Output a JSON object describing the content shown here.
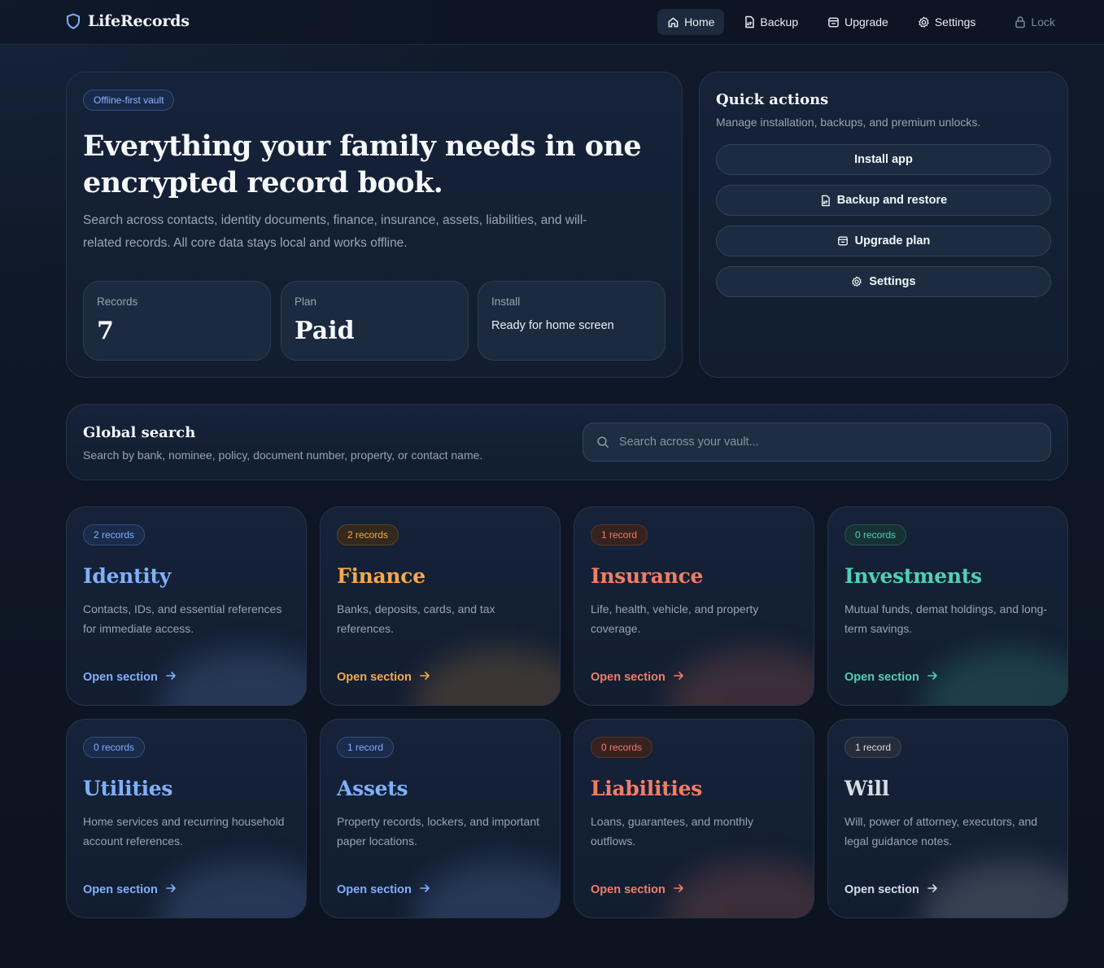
{
  "app": {
    "name": "LifeRecords"
  },
  "nav": [
    {
      "label": "Home",
      "icon": "home-icon",
      "active": true
    },
    {
      "label": "Backup",
      "icon": "backup-icon"
    },
    {
      "label": "Upgrade",
      "icon": "upgrade-icon"
    },
    {
      "label": "Settings",
      "icon": "gear-icon"
    },
    {
      "label": "Lock",
      "icon": "lock-icon"
    }
  ],
  "hero": {
    "badge": "Offline-first vault",
    "title": "Everything your family needs in one encrypted record book.",
    "description": "Search across contacts, identity documents, finance, insurance, assets, liabilities, and will-related records. All core data stays local and works offline.",
    "stats": [
      {
        "label": "Records",
        "value": "7"
      },
      {
        "label": "Plan",
        "value": "Paid"
      },
      {
        "label": "Install",
        "value": "Ready for home screen"
      }
    ]
  },
  "quick_actions": {
    "title": "Quick actions",
    "subtitle": "Manage installation, backups, and premium unlocks.",
    "buttons": [
      {
        "label": "Install app",
        "icon": ""
      },
      {
        "label": "Backup and restore",
        "icon": "backup-icon"
      },
      {
        "label": "Upgrade plan",
        "icon": "upgrade-icon"
      },
      {
        "label": "Settings",
        "icon": "gear-icon"
      }
    ]
  },
  "search": {
    "title": "Global search",
    "subtitle": "Search by bank, nominee, policy, document number, property, or contact name.",
    "placeholder": "Search across your vault..."
  },
  "categories": [
    {
      "title": "Identity",
      "count": "2 records",
      "description": "Contacts, IDs, and essential references for immediate access.",
      "cta": "Open section",
      "color": "#7fb0ff",
      "badge_bg": "#1a2b4b",
      "badge_border": "#34507e"
    },
    {
      "title": "Finance",
      "count": "2 records",
      "description": "Banks, deposits, cards, and tax references.",
      "cta": "Open section",
      "color": "#f6a94a",
      "badge_bg": "#33291d",
      "badge_border": "#5a4426"
    },
    {
      "title": "Insurance",
      "count": "1 record",
      "description": "Life, health, vehicle, and property coverage.",
      "cta": "Open section",
      "color": "#f27d66",
      "badge_bg": "#36221f",
      "badge_border": "#5c322a"
    },
    {
      "title": "Investments",
      "count": "0 records",
      "description": "Mutual funds, demat holdings, and long-term savings.",
      "cta": "Open section",
      "color": "#4fd1b5",
      "badge_bg": "#163232",
      "badge_border": "#28544e"
    },
    {
      "title": "Utilities",
      "count": "0 records",
      "description": "Home services and recurring household account references.",
      "cta": "Open section",
      "color": "#7fb0ff",
      "badge_bg": "#1a2b4b",
      "badge_border": "#34507e"
    },
    {
      "title": "Assets",
      "count": "1 record",
      "description": "Property records, lockers, and important paper locations.",
      "cta": "Open section",
      "color": "#7fb0ff",
      "badge_bg": "#1a2b4b",
      "badge_border": "#34507e"
    },
    {
      "title": "Liabilities",
      "count": "0 records",
      "description": "Loans, guarantees, and monthly outflows.",
      "cta": "Open section",
      "color": "#f27d66",
      "badge_bg": "#36221f",
      "badge_border": "#5c322a"
    },
    {
      "title": "Will",
      "count": "1 record",
      "description": "Will, power of attorney, executors, and legal guidance notes.",
      "cta": "Open section",
      "color": "#d7dde7",
      "badge_bg": "#252d3a",
      "badge_border": "#3c4657"
    }
  ]
}
